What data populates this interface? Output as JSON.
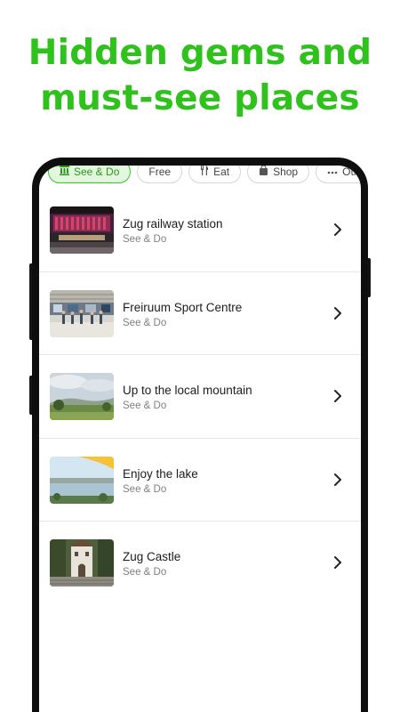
{
  "headline": {
    "line1": "Hidden gems and",
    "line2": "must-see places",
    "color": "#2fc21c"
  },
  "filters": [
    {
      "label": "See & Do",
      "icon": "columns-icon",
      "active": true
    },
    {
      "label": "Free",
      "icon": "",
      "active": false
    },
    {
      "label": "Eat",
      "icon": "cutlery-icon",
      "active": false
    },
    {
      "label": "Shop",
      "icon": "shopping-bag-icon",
      "active": false
    },
    {
      "label": "Other",
      "icon": "more-dots-icon",
      "active": false
    }
  ],
  "places": [
    {
      "title": "Zug railway station",
      "category": "See & Do",
      "image": "railway-station-photo"
    },
    {
      "title": "Freiruum Sport Centre",
      "category": "See & Do",
      "image": "sport-centre-photo"
    },
    {
      "title": "Up to the local mountain",
      "category": "See & Do",
      "image": "mountain-view-photo"
    },
    {
      "title": "Enjoy the lake",
      "category": "See & Do",
      "image": "lake-photo"
    },
    {
      "title": "Zug Castle",
      "category": "See & Do",
      "image": "castle-photo"
    }
  ]
}
